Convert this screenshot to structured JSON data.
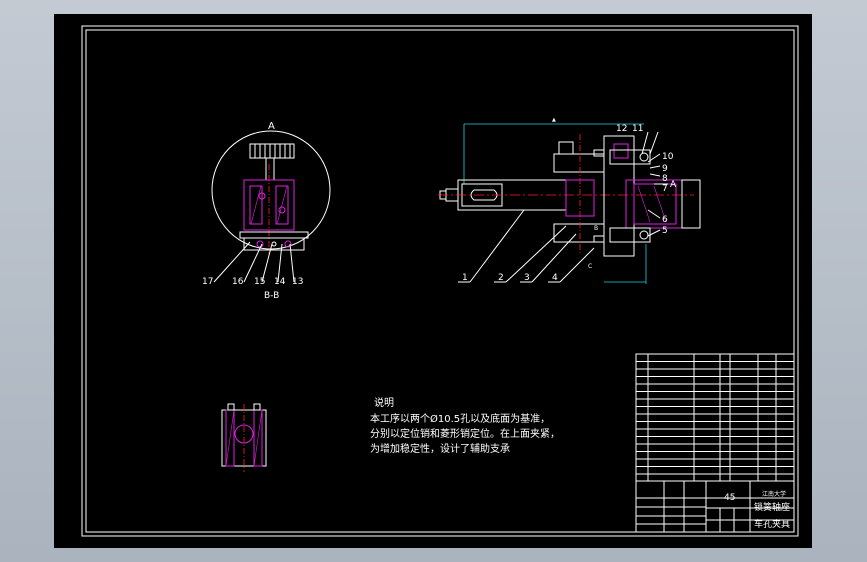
{
  "view_labels": {
    "a": "A",
    "bb": "B-B",
    "b": "B",
    "c": "C",
    "arrow_a": "A"
  },
  "part_numbers_right": [
    "12",
    "11",
    "10",
    "9",
    "8",
    "7",
    "6",
    "5"
  ],
  "part_numbers_bottom": [
    "1",
    "2",
    "3",
    "4"
  ],
  "part_numbers_left": [
    "17",
    "16",
    "15",
    "14",
    "13"
  ],
  "notes": {
    "heading": "说明",
    "lines": [
      "本工序以两个Ø10.5孔以及底面为基准，",
      "分别以定位销和菱形销定位。在上面夹紧，",
      "为增加稳定性，设计了辅助支承"
    ]
  },
  "title_block": {
    "material": "45",
    "part_name": "锁簧轴座",
    "drawing_name": "车孔夹具",
    "school": "江南大学"
  },
  "colors": {
    "sheet": "#000000",
    "frame": "#ffffff",
    "part": "#e020e0",
    "center_line": "#ff2020",
    "dimension": "#20d0e0"
  }
}
